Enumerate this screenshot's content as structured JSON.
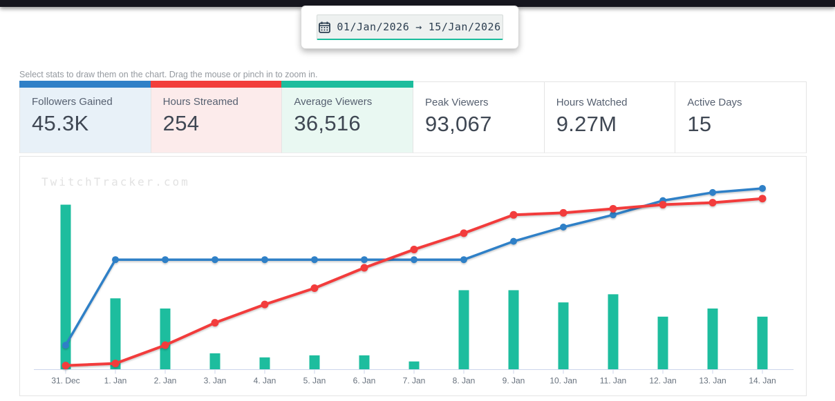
{
  "date_picker": {
    "start_date": "01/Jan/2026",
    "arrow": "→",
    "end_date": "15/Jan/2026"
  },
  "helper_text": "Select stats to draw them on the chart. Drag the mouse or pinch in to zoom in.",
  "stats": [
    {
      "label": "Followers Gained",
      "value": "45.3K",
      "selected": true,
      "accent": "#2f80c7",
      "bg": "#e8f1f8"
    },
    {
      "label": "Hours Streamed",
      "value": "254",
      "selected": true,
      "accent": "#f23e3b",
      "bg": "#fcebeb"
    },
    {
      "label": "Average Viewers",
      "value": "36,516",
      "selected": true,
      "accent": "#1cbd9d",
      "bg": "#e9f8f2"
    },
    {
      "label": "Peak Viewers",
      "value": "93,067",
      "selected": false
    },
    {
      "label": "Hours Watched",
      "value": "9.27M",
      "selected": false
    },
    {
      "label": "Active Days",
      "value": "15",
      "selected": false
    }
  ],
  "chart_data": {
    "type": "mixed",
    "watermark": "TwitchTracker.com",
    "categories": [
      "31. Dec",
      "1. Jan",
      "2. Jan",
      "3. Jan",
      "4. Jan",
      "5. Jan",
      "6. Jan",
      "7. Jan",
      "8. Jan",
      "9. Jan",
      "10. Jan",
      "11. Jan",
      "12. Jan",
      "13. Jan",
      "14. Jan"
    ],
    "y_axis_visible": false,
    "y_unit": "percent_of_plot_height",
    "grid": false,
    "legend": "none",
    "axis_color": "#ccd6eb",
    "label_color": "#66707c",
    "series": [
      {
        "name": "Followers Gained",
        "type": "line",
        "color": "#2f80c7",
        "values": [
          12,
          54,
          54,
          54,
          54,
          54,
          54,
          54,
          54,
          63,
          70,
          76,
          83,
          87,
          89
        ]
      },
      {
        "name": "Hours Streamed",
        "type": "line",
        "color": "#f23c3c",
        "values": [
          2,
          3,
          12,
          23,
          32,
          40,
          50,
          59,
          67,
          76,
          77,
          79,
          81,
          82,
          84
        ]
      },
      {
        "name": "Average Viewers",
        "type": "bar",
        "color": "#1dbd9e",
        "values": [
          81,
          35,
          30,
          8,
          6,
          7,
          7,
          4,
          39,
          39,
          33,
          37,
          26,
          30,
          26
        ]
      }
    ]
  }
}
